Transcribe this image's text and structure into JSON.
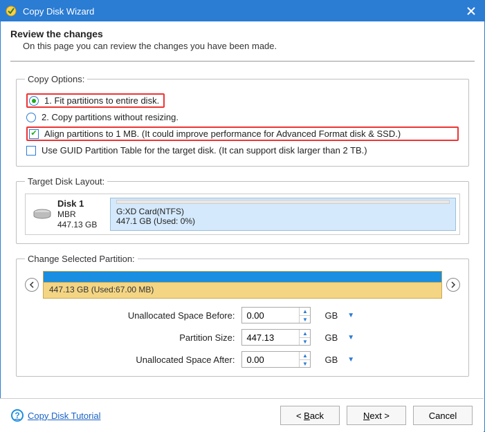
{
  "window": {
    "title": "Copy Disk Wizard"
  },
  "header": {
    "title": "Review the changes",
    "subtitle": "On this page you can review the changes you have been made."
  },
  "options": {
    "legend": "Copy Options:",
    "radio1": "1. Fit partitions to entire disk.",
    "radio2": "2. Copy partitions without resizing.",
    "check1": "Align partitions to 1 MB.  (It could improve performance for Advanced Format disk & SSD.)",
    "check2": "Use GUID Partition Table for the target disk. (It can support disk larger than 2 TB.)"
  },
  "target": {
    "legend": "Target Disk Layout:",
    "disk_name": "Disk 1",
    "disk_type": "MBR",
    "disk_size": "447.13 GB",
    "part_label": "G:XD Card(NTFS)",
    "part_usage": "447.1 GB (Used: 0%)"
  },
  "change": {
    "legend": "Change Selected Partition:",
    "slider_label": "447.13 GB (Used:67.00 MB)",
    "fields": {
      "before_label": "Unallocated Space Before:",
      "before_value": "0.00",
      "size_label": "Partition Size:",
      "size_value": "447.13",
      "after_label": "Unallocated Space After:",
      "after_value": "0.00",
      "unit": "GB"
    }
  },
  "footer": {
    "help": "Copy Disk Tutorial",
    "back": "< Back",
    "next": "Next >",
    "cancel": "Cancel"
  }
}
